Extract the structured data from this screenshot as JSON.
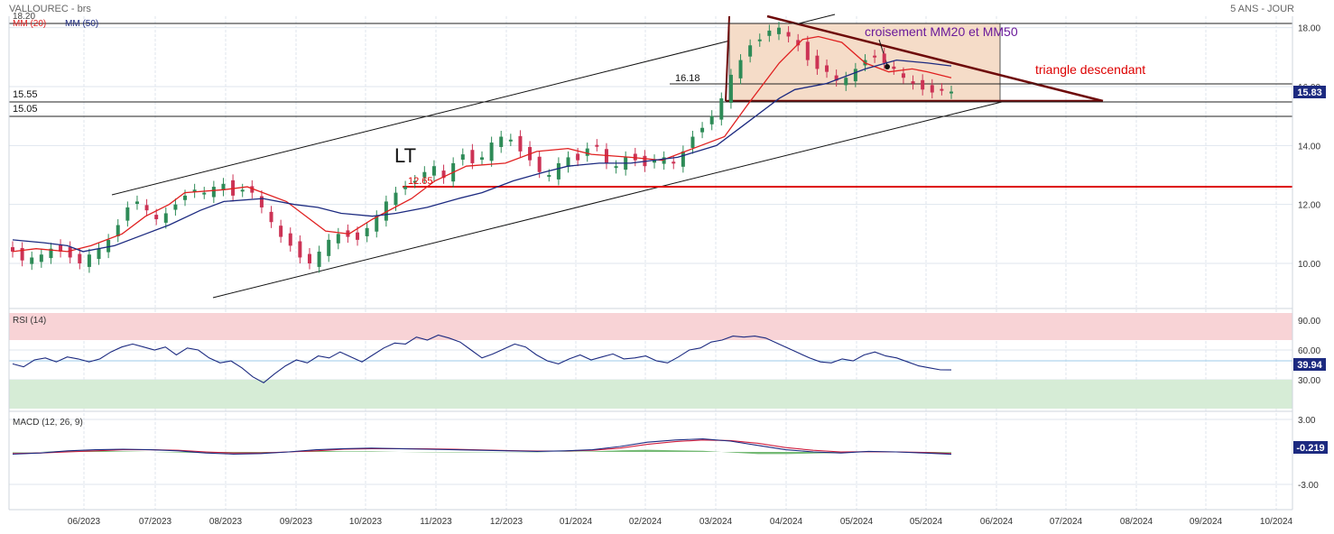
{
  "header": {
    "title": "VALLOUREC - brs",
    "period": "5 ANS - JOUR",
    "ma20_label": "MM (20)",
    "ma50_label": "MM (50)",
    "top_value_label": "18.20"
  },
  "colors": {
    "grid": "#dfe6ee",
    "axis_text": "#333333",
    "candle_up": "#2e8b57",
    "candle_down": "#cc3355",
    "ma20": "#e02020",
    "ma50": "#1c2a80",
    "triangle_fill": "#f5dcc8",
    "triangle_line": "#6e0a0a",
    "rsi_line": "#1c2a80",
    "rsi_overbought": "#f8d3d6",
    "rsi_oversold": "#d6ecd6",
    "macd_line": "#1c2a80",
    "signal_line": "#d02040",
    "histogram": "#3a9d3a",
    "badge_bg": "#1c2a80",
    "support_red": "#dd0000"
  },
  "annotations": {
    "lt_label": "LT",
    "cross_label": "croisement MM20 et MM50",
    "triangle_label": "triangle descendant",
    "level_1618": "16.18",
    "level_1555": "15.55",
    "level_1505": "15.05",
    "level_1265": "12.65",
    "last_price_badge": "15.83"
  },
  "rsi": {
    "title": "RSI (14)",
    "ticks": [
      "90.00",
      "60.00",
      "30.00"
    ],
    "last_badge": "39.94"
  },
  "macd": {
    "title": "MACD (12, 26, 9)",
    "ticks": [
      "3.00",
      "-3.00"
    ],
    "last_badge": "-0.219"
  },
  "chart_data": {
    "type": "line",
    "x": [
      "06/2023",
      "07/2023",
      "08/2023",
      "09/2023",
      "10/2023",
      "11/2023",
      "12/2023",
      "01/2024",
      "02/2024",
      "03/2024",
      "04/2024",
      "05/2024",
      "05/2024",
      "06/2024",
      "07/2024",
      "08/2024",
      "09/2024",
      "10/2024"
    ],
    "xlabel": "",
    "ylabel": "",
    "price_panel": {
      "ylim": [
        9.0,
        18.5
      ],
      "yticks": [
        "18.00",
        "16.00",
        "14.00",
        "12.00",
        "10.00"
      ],
      "series": [
        {
          "name": "MM (20)",
          "points": [
            [
              0,
              10.4
            ],
            [
              3,
              10.5
            ],
            [
              7,
              10.4
            ],
            [
              10,
              10.6
            ],
            [
              14,
              11.0
            ],
            [
              17,
              11.6
            ],
            [
              20,
              12.0
            ],
            [
              22,
              12.4
            ],
            [
              27,
              12.5
            ],
            [
              30,
              12.6
            ],
            [
              35,
              12.1
            ],
            [
              40,
              11.1
            ],
            [
              43,
              11.0
            ],
            [
              46,
              11.5
            ],
            [
              51,
              12.2
            ],
            [
              54,
              12.8
            ],
            [
              58,
              13.3
            ],
            [
              63,
              13.4
            ],
            [
              67,
              13.8
            ],
            [
              71,
              13.9
            ],
            [
              74,
              13.7
            ],
            [
              79,
              13.6
            ],
            [
              83,
              13.5
            ],
            [
              88,
              14.0
            ],
            [
              91,
              14.3
            ],
            [
              94,
              15.4
            ],
            [
              98,
              16.8
            ],
            [
              101,
              17.6
            ],
            [
              103,
              17.7
            ],
            [
              106,
              17.5
            ],
            [
              109,
              16.8
            ],
            [
              112,
              16.5
            ],
            [
              115,
              16.6
            ],
            [
              117,
              16.5
            ],
            [
              120,
              16.3
            ]
          ]
        },
        {
          "name": "MM (50)",
          "points": [
            [
              0,
              10.8
            ],
            [
              4,
              10.7
            ],
            [
              7,
              10.6
            ],
            [
              9,
              10.4
            ],
            [
              13,
              10.6
            ],
            [
              17,
              11.0
            ],
            [
              20,
              11.3
            ],
            [
              24,
              11.8
            ],
            [
              27,
              12.1
            ],
            [
              32,
              12.2
            ],
            [
              36,
              12.0
            ],
            [
              39,
              11.9
            ],
            [
              42,
              11.7
            ],
            [
              46,
              11.6
            ],
            [
              49,
              11.7
            ],
            [
              53,
              11.9
            ],
            [
              57,
              12.2
            ],
            [
              60,
              12.4
            ],
            [
              64,
              12.8
            ],
            [
              68,
              13.1
            ],
            [
              71,
              13.3
            ],
            [
              75,
              13.4
            ],
            [
              79,
              13.4
            ],
            [
              85,
              13.6
            ],
            [
              90,
              14.0
            ],
            [
              94,
              14.8
            ],
            [
              98,
              15.6
            ],
            [
              100,
              15.9
            ],
            [
              104,
              16.1
            ],
            [
              109,
              16.6
            ],
            [
              113,
              16.9
            ],
            [
              117,
              16.8
            ],
            [
              120,
              16.7
            ]
          ]
        }
      ],
      "candles_close": [
        10.4,
        10.1,
        10.2,
        10.3,
        10.5,
        10.4,
        10.2,
        10.0,
        10.3,
        10.5,
        10.8,
        11.3,
        11.9,
        12.1,
        11.8,
        11.5,
        11.7,
        12.0,
        12.3,
        12.5,
        12.4,
        12.6,
        12.7,
        12.3,
        12.5,
        12.4,
        11.9,
        11.4,
        10.9,
        10.6,
        10.2,
        10.0,
        10.4,
        10.8,
        11.0,
        10.9,
        10.8,
        11.2,
        11.6,
        12.1,
        12.4,
        12.6,
        12.8,
        13.1,
        13.3,
        12.9,
        13.4,
        13.7,
        13.4,
        13.6,
        14.1,
        14.3,
        14.2,
        13.8,
        13.5,
        13.1,
        13.0,
        13.4,
        13.6,
        13.5,
        13.9,
        14.0,
        13.4,
        13.3,
        13.6,
        13.5,
        13.3,
        13.5,
        13.6,
        13.4,
        13.8,
        14.3,
        14.6,
        15.0,
        15.6,
        16.4,
        16.9,
        17.4,
        17.6,
        17.9,
        18.0,
        17.7,
        17.4,
        16.9,
        16.6,
        16.5,
        16.2,
        16.3,
        16.6,
        16.9,
        17.0,
        16.8,
        16.6,
        16.3,
        16.1,
        15.9,
        15.8,
        15.9,
        15.83
      ],
      "levels": [
        18.2,
        16.18,
        15.55,
        15.05,
        12.65
      ]
    },
    "rsi_panel": {
      "ylim": [
        0,
        100
      ],
      "values": [
        46,
        43,
        50,
        52,
        48,
        53,
        51,
        48,
        51,
        58,
        63,
        66,
        63,
        60,
        63,
        55,
        62,
        60,
        52,
        47,
        49,
        42,
        33,
        27,
        36,
        44,
        50,
        47,
        54,
        52,
        58,
        53,
        48,
        55,
        62,
        67,
        66,
        73,
        70,
        75,
        72,
        68,
        60,
        52,
        56,
        61,
        66,
        63,
        55,
        49,
        46,
        51,
        55,
        50,
        53,
        56,
        51,
        52,
        54,
        49,
        47,
        53,
        60,
        62,
        68,
        70,
        74,
        73,
        74,
        72,
        67,
        62,
        57,
        52,
        48,
        47,
        51,
        49,
        55,
        58,
        54,
        52,
        48,
        44,
        42,
        40,
        39.94
      ]
    },
    "macd_panel": {
      "ylim": [
        -4,
        4
      ],
      "macd": [
        -0.2,
        -0.1,
        0.1,
        0.2,
        0.25,
        0.2,
        0.1,
        -0.1,
        -0.2,
        -0.15,
        0.0,
        0.2,
        0.3,
        0.35,
        0.3,
        0.25,
        0.2,
        0.15,
        0.1,
        0.05,
        0.1,
        0.2,
        0.5,
        0.9,
        1.1,
        1.2,
        1.0,
        0.6,
        0.2,
        0.0,
        -0.1,
        0.05,
        0.0,
        -0.1,
        -0.219
      ],
      "signal": [
        -0.15,
        -0.1,
        0.0,
        0.1,
        0.2,
        0.2,
        0.15,
        0.0,
        -0.1,
        -0.1,
        0.0,
        0.1,
        0.25,
        0.3,
        0.3,
        0.28,
        0.24,
        0.18,
        0.12,
        0.08,
        0.08,
        0.15,
        0.35,
        0.7,
        0.95,
        1.1,
        1.05,
        0.8,
        0.4,
        0.15,
        0.0,
        0.02,
        0.0,
        -0.05,
        -0.15
      ]
    }
  }
}
